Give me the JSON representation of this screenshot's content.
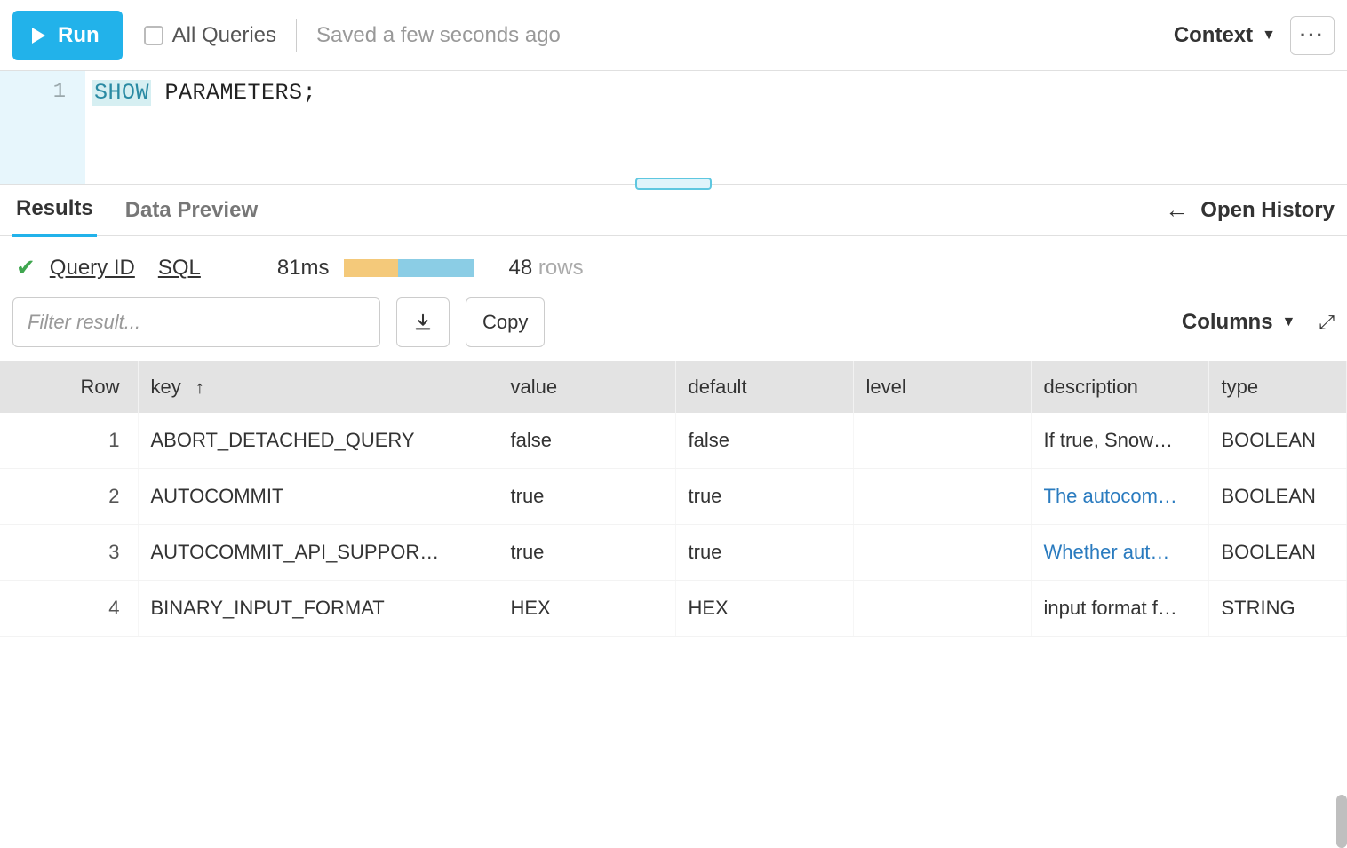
{
  "toolbar": {
    "run_label": "Run",
    "all_queries_label": "All Queries",
    "saved_status": "Saved a few seconds ago",
    "context_label": "Context",
    "more_label": "···"
  },
  "editor": {
    "line_number": "1",
    "keyword": "SHOW",
    "identifier": "PARAMETERS",
    "terminator": ";"
  },
  "tabs": {
    "results_label": "Results",
    "data_preview_label": "Data Preview",
    "open_history_label": "Open History"
  },
  "status": {
    "query_id_label": "Query ID",
    "sql_label": "SQL",
    "duration": "81ms",
    "row_count_num": "48",
    "row_count_label": "rows"
  },
  "filter": {
    "placeholder": "Filter result...",
    "copy_label": "Copy",
    "columns_label": "Columns"
  },
  "columns": {
    "row": "Row",
    "key": "key",
    "value": "value",
    "default": "default",
    "level": "level",
    "description": "description",
    "type": "type",
    "sort_arrow": "↑"
  },
  "rows": [
    {
      "n": "1",
      "key": "ABORT_DETACHED_QUERY",
      "value": "false",
      "default": "false",
      "level": "",
      "desc": "If true, Snow…",
      "desc_link": false,
      "type": "BOOLEAN"
    },
    {
      "n": "2",
      "key": "AUTOCOMMIT",
      "value": "true",
      "default": "true",
      "level": "",
      "desc": "The autocom…",
      "desc_link": true,
      "type": "BOOLEAN"
    },
    {
      "n": "3",
      "key": "AUTOCOMMIT_API_SUPPOR…",
      "value": "true",
      "default": "true",
      "level": "",
      "desc": "Whether aut…",
      "desc_link": true,
      "type": "BOOLEAN"
    },
    {
      "n": "4",
      "key": "BINARY_INPUT_FORMAT",
      "value": "HEX",
      "default": "HEX",
      "level": "",
      "desc": "input format f…",
      "desc_link": false,
      "type": "STRING"
    }
  ]
}
